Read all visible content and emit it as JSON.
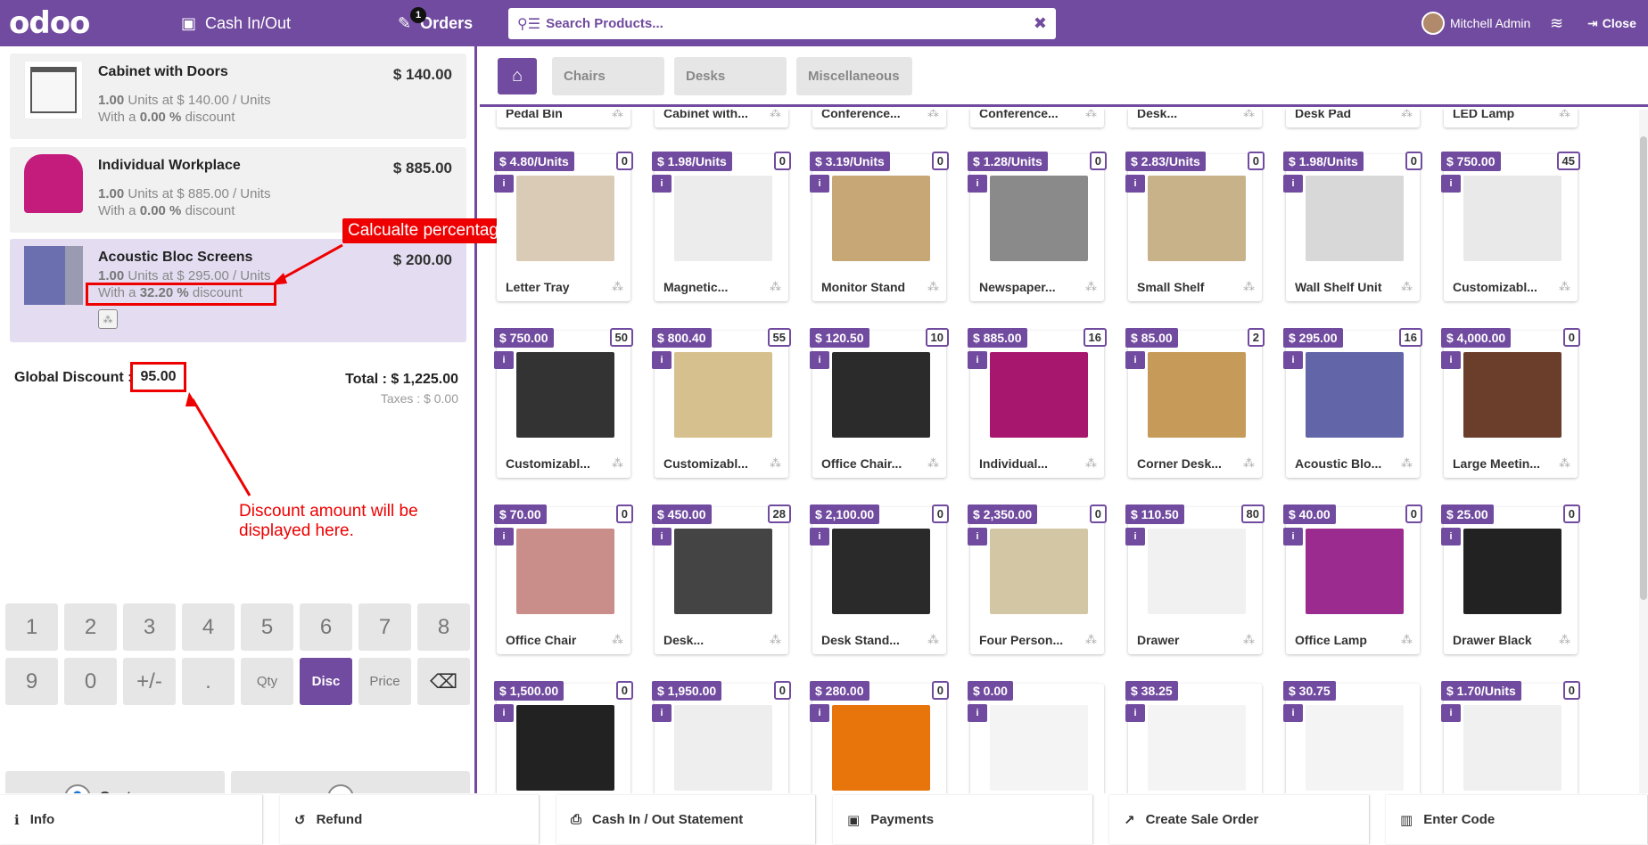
{
  "topbar": {
    "logo": "odoo",
    "cash_label": "Cash In/Out",
    "orders_label": "Orders",
    "orders_badge": "1",
    "search_placeholder": "Search Products...",
    "user_name": "Mitchell Admin",
    "close_label": "Close",
    "accent": "#714B9F"
  },
  "orderlines": [
    {
      "name": "Cabinet with Doors",
      "price": "$ 140.00",
      "qty": "1.00",
      "unit_text": "Units at $ 140.00 / Units",
      "disc_prefix": "With a",
      "disc_value": "0.00 %",
      "disc_suffix": "discount"
    },
    {
      "name": "Individual Workplace",
      "price": "$ 885.00",
      "qty": "1.00",
      "unit_text": "Units at $ 885.00 / Units",
      "disc_prefix": "With a",
      "disc_value": "0.00 %",
      "disc_suffix": "discount"
    },
    {
      "name": "Acoustic Bloc Screens",
      "price": "$ 200.00",
      "qty": "1.00",
      "unit_text": "Units at $ 295.00 / Units",
      "disc_prefix": "With a",
      "disc_value": "32.20 %",
      "disc_suffix": "discount"
    }
  ],
  "summary": {
    "global_discount_label": "Global Discount :",
    "global_discount_value": "95.00",
    "total": "Total : $ 1,225.00",
    "taxes": "Taxes : $ 0.00"
  },
  "annotations": {
    "auto_pct": "Calcualte percentage automatically.",
    "discount_here": "Discount amount will be displayed here."
  },
  "numpad": {
    "row1": [
      "1",
      "2",
      "3",
      "4",
      "5",
      "6",
      "7",
      "8"
    ],
    "row2": [
      "9",
      "0",
      "+/-",
      ".",
      "Qty",
      "Disc",
      "Price"
    ],
    "customer": "Customer"
  },
  "categories": [
    "Chairs",
    "Desks",
    "Miscellaneous"
  ],
  "partial_row": [
    "Pedal Bin",
    "Cabinet with...",
    "Conference...",
    "Conference...",
    "Desk...",
    "Desk Pad",
    "LED Lamp"
  ],
  "products": [
    [
      {
        "name": "Letter Tray",
        "price": "$ 4.80/Units",
        "qty": "0"
      },
      {
        "name": "Magnetic...",
        "price": "$ 1.98/Units",
        "qty": "0"
      },
      {
        "name": "Monitor Stand",
        "price": "$ 3.19/Units",
        "qty": "0"
      },
      {
        "name": "Newspaper...",
        "price": "$ 1.28/Units",
        "qty": "0"
      },
      {
        "name": "Small Shelf",
        "price": "$ 2.83/Units",
        "qty": "0"
      },
      {
        "name": "Wall Shelf Unit",
        "price": "$ 1.98/Units",
        "qty": "0"
      },
      {
        "name": "Customizabl...",
        "price": "$ 750.00",
        "qty": "45"
      }
    ],
    [
      {
        "name": "Customizabl...",
        "price": "$ 750.00",
        "qty": "50"
      },
      {
        "name": "Customizabl...",
        "price": "$ 800.40",
        "qty": "55"
      },
      {
        "name": "Office Chair...",
        "price": "$ 120.50",
        "qty": "10"
      },
      {
        "name": "Individual...",
        "price": "$ 885.00",
        "qty": "16"
      },
      {
        "name": "Corner Desk...",
        "price": "$ 85.00",
        "qty": "2"
      },
      {
        "name": "Acoustic Blo...",
        "price": "$ 295.00",
        "qty": "16"
      },
      {
        "name": "Large Meetin...",
        "price": "$ 4,000.00",
        "qty": "0"
      }
    ],
    [
      {
        "name": "Office Chair",
        "price": "$ 70.00",
        "qty": "0"
      },
      {
        "name": "Desk...",
        "price": "$ 450.00",
        "qty": "28"
      },
      {
        "name": "Desk Stand...",
        "price": "$ 2,100.00",
        "qty": "0"
      },
      {
        "name": "Four Person...",
        "price": "$ 2,350.00",
        "qty": "0"
      },
      {
        "name": "Drawer",
        "price": "$ 110.50",
        "qty": "80"
      },
      {
        "name": "Office Lamp",
        "price": "$ 40.00",
        "qty": "0"
      },
      {
        "name": "Drawer Black",
        "price": "$ 25.00",
        "qty": "0"
      }
    ],
    [
      {
        "name": "",
        "price": "$ 1,500.00",
        "qty": "0"
      },
      {
        "name": "",
        "price": "$ 1,950.00",
        "qty": "0"
      },
      {
        "name": "",
        "price": "$ 280.00",
        "qty": "0"
      },
      {
        "name": "",
        "price": "$ 0.00",
        "qty": ""
      },
      {
        "name": "",
        "price": "$ 38.25",
        "qty": ""
      },
      {
        "name": "",
        "price": "$ 30.75",
        "qty": ""
      },
      {
        "name": "",
        "price": "$ 1.70/Units",
        "qty": "0"
      }
    ]
  ],
  "footer": [
    "Info",
    "Refund",
    "Cash In / Out Statement",
    "Payments",
    "Create Sale Order",
    "Enter Code"
  ]
}
